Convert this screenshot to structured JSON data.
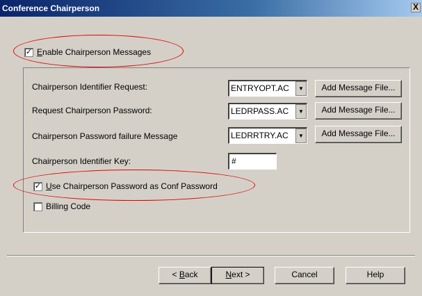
{
  "window": {
    "title": "Conference Chairperson",
    "close_label": "X"
  },
  "enable_messages": {
    "label_first": "E",
    "label_rest": "nable Chairperson Messages",
    "checked": true
  },
  "rows": [
    {
      "label": "Chairperson Identifier Request:",
      "value": "ENTRYOPT.AC",
      "button": "Add Message File..."
    },
    {
      "label": "Request Chairperson Password:",
      "value": "LEDRPASS.AC",
      "button": "Add Message File..."
    },
    {
      "label": "Chairperson Password failure Message",
      "value": "LEDRRTRY.AC",
      "button": "Add Message File..."
    }
  ],
  "identifier_key": {
    "label": "Chairperson Identifier Key:",
    "value": "#"
  },
  "use_password": {
    "label_first": "U",
    "label_rest": "se Chairperson Password as Conf Password",
    "checked": true
  },
  "billing_code": {
    "label": "Billing Code",
    "checked": false
  },
  "buttons": {
    "back_prefix": "< ",
    "back_ul": "B",
    "back_rest": "ack",
    "next_ul": "N",
    "next_rest": "ext >",
    "cancel": "Cancel",
    "help": "Help"
  },
  "check_glyph": "✓",
  "colors": {
    "annotation": "#e00000",
    "dialog": "#d4d0c8",
    "titlebar": "#0a246a"
  }
}
